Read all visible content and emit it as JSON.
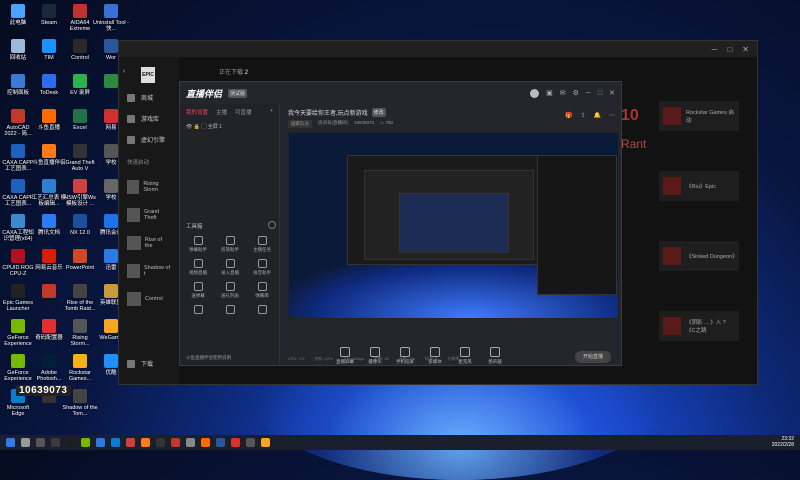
{
  "desktop_icons": [
    {
      "label": "此电脑",
      "color": "#4aa3ff"
    },
    {
      "label": "Steam",
      "color": "#1b2838"
    },
    {
      "label": "AIDA64 Extreme",
      "color": "#c23030"
    },
    {
      "label": "Uninstall Tool - 快...",
      "color": "#3a6fd8"
    },
    {
      "label": "回收站",
      "color": "#9db9d8"
    },
    {
      "label": "TIM",
      "color": "#1e90ff"
    },
    {
      "label": "Control",
      "color": "#2a2a2a"
    },
    {
      "label": "Wor",
      "color": "#2b579a"
    },
    {
      "label": "控制面板",
      "color": "#3a7bd5"
    },
    {
      "label": "ToDesk",
      "color": "#2d6cf0"
    },
    {
      "label": "EV 录屏",
      "color": "#2bb24c"
    },
    {
      "label": "",
      "color": "#2b8a3e"
    },
    {
      "label": "AutoCAD 2022 - 简...",
      "color": "#c0392b"
    },
    {
      "label": "斗鱼直播",
      "color": "#ff6b00"
    },
    {
      "label": "Excel",
      "color": "#217346"
    },
    {
      "label": "网易",
      "color": "#d03030"
    },
    {
      "label": "CAXA CAPP 工艺图表...",
      "color": "#1f5fbf"
    },
    {
      "label": "斗鱼直播伴侣",
      "color": "#ff7a1a"
    },
    {
      "label": "Grand Theft Auto V",
      "color": "#333"
    },
    {
      "label": "学校",
      "color": "#555"
    },
    {
      "label": "CAXA CAPP 工艺图表...",
      "color": "#1f5fbf"
    },
    {
      "label": "工艺汇总表 模板编辑...",
      "color": "#2f7fd0"
    },
    {
      "label": "NSW引擎Ws 模板设计 ...",
      "color": "#d04040"
    },
    {
      "label": "学校",
      "color": "#666"
    },
    {
      "label": "CAXA工程知识管理(x64)",
      "color": "#3a8ad0"
    },
    {
      "label": "腾讯文档",
      "color": "#2d7bf0"
    },
    {
      "label": "NX 12.0",
      "color": "#1d4f9f"
    },
    {
      "label": "腾讯会议",
      "color": "#1a73e8"
    },
    {
      "label": "CPUID ROG CPU-Z",
      "color": "#b01020"
    },
    {
      "label": "网易云音乐",
      "color": "#d81e06"
    },
    {
      "label": "PowerPoint",
      "color": "#d24726"
    },
    {
      "label": "迅雷",
      "color": "#2c7be5"
    },
    {
      "label": "Epic Games Launcher",
      "color": "#222"
    },
    {
      "label": "",
      "color": "#c0392b"
    },
    {
      "label": "Rise of the Tomb Raid...",
      "color": "#444"
    },
    {
      "label": "英雄联盟",
      "color": "#c89b3c"
    },
    {
      "label": "GeForce Experience",
      "color": "#76b900"
    },
    {
      "label": "奇码配置器",
      "color": "#e03030"
    },
    {
      "label": "Rising Storm...",
      "color": "#555"
    },
    {
      "label": "WeGame",
      "color": "#f5a623"
    },
    {
      "label": "GeForce Experience",
      "color": "#76b900"
    },
    {
      "label": "Adobe Photosh...",
      "color": "#001e36"
    },
    {
      "label": "Rockstar Games...",
      "color": "#fcaf17"
    },
    {
      "label": "优酷",
      "color": "#1e90ff"
    },
    {
      "label": "Microsoft Edge",
      "color": "#0c7bd3"
    },
    {
      "label": "",
      "color": "#333"
    },
    {
      "label": "Shadow of the Tom...",
      "color": "#444"
    },
    {
      "label": "",
      "color": "#0000"
    }
  ],
  "epic": {
    "sidebar": [
      {
        "label": "商城"
      },
      {
        "label": "游戏库"
      },
      {
        "label": "虚幻引擎"
      }
    ],
    "quick_launch_title": "快速启动",
    "games": [
      "Rising Storm",
      "Grand Theft",
      "Rise of the",
      "Shadow of t",
      "Control"
    ],
    "download": "下载",
    "store_head": "正在下载",
    "store_count": "2",
    "cards": [
      {
        "label": "Rockstar Games 启动"
      },
      {
        "label": "《Riu》Epic"
      },
      {
        "label": "《Sinked Dungeon》"
      },
      {
        "label": "《阴影 ... 》入 ?《C之跳"
      }
    ],
    "big_text": "10",
    "big_text2": "Rant"
  },
  "live": {
    "logo": "直播伴侣",
    "version": "测试版",
    "tabs": [
      "我的设置",
      "主播",
      "可直播"
    ],
    "scene": "全屏 1",
    "tools_title": "工具箱",
    "tools": [
      "弹幕助手",
      "房管助手",
      "主播任务",
      "视频直播",
      "录入直播",
      "语音助手",
      "送弹幕",
      "送礼列表",
      "弹幕库",
      "",
      "",
      ""
    ],
    "footer": "斗鱼直播伴侣使用说明",
    "room_title": "我今天要给你王者,玩点新游戏",
    "room_tag": "修改",
    "room_sub_tag": "国家队员",
    "room_id_label": "房间号(直播间)",
    "room_id": "10639073",
    "likes": "750",
    "bottom_buttons": [
      "直播屏幕",
      "摄像头",
      "手机投屏",
      "多媒体",
      "麦克风",
      "扬声器"
    ],
    "start_button": "开始直播",
    "status_items": [
      "CPU: 1%",
      "内存: 12%",
      "上行: 0Kbps",
      "帧数: 60",
      "丢帧: 0%",
      "码率: 0",
      "分辨率"
    ]
  },
  "overlay_id": "10639073",
  "clock": {
    "time": "23:32",
    "date": "2022/2/28"
  }
}
